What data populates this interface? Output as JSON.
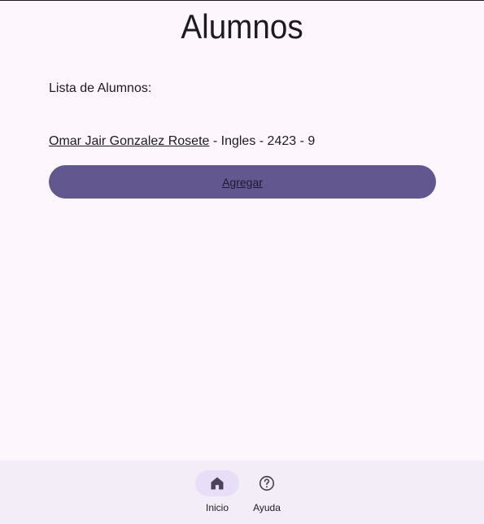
{
  "header": {
    "title": "Alumnos"
  },
  "main": {
    "list_label": "Lista de Alumnos:",
    "students": [
      {
        "name": "Omar Jair Gonzalez Rosete",
        "details": " - Ingles - 2423 - 9"
      }
    ],
    "add_button_label": "Agregar"
  },
  "bottom_nav": {
    "items": [
      {
        "label": "Inicio",
        "icon": "home-icon",
        "active": true
      },
      {
        "label": "Ayuda",
        "icon": "help-circle-icon",
        "active": false
      }
    ]
  },
  "colors": {
    "background": "#fdf7fd",
    "button": "#63578f",
    "nav_background": "#f3edf7",
    "active_pill": "#e8def8",
    "text": "#1d1b20"
  }
}
